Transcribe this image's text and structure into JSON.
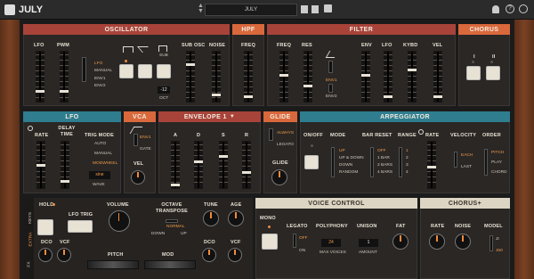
{
  "topbar": {
    "title": "JULY",
    "preset": "JULY"
  },
  "osc": {
    "title": "OSCILLATOR",
    "lfo": "LFO",
    "pwm": "PWM",
    "sub_osc": "SUB OSC",
    "noise": "NOISE",
    "mod": [
      "LFO",
      "MANUAL",
      "ENV1",
      "ENV2"
    ],
    "oct_value": "-12",
    "oct": "OCT",
    "sub": "SUB"
  },
  "hpf": {
    "title": "HPF",
    "freq": "FREQ"
  },
  "filter": {
    "title": "FILTER",
    "freq": "FREQ",
    "res": "RES",
    "env": "ENV",
    "lfo": "LFO",
    "kybd": "KYBD",
    "vel": "VEL",
    "env_opts": [
      "ENV1",
      "ENV2"
    ]
  },
  "chorus": {
    "title": "CHORUS",
    "i": "I",
    "ii": "II"
  },
  "lfo": {
    "title": "LFO",
    "rate": "RATE",
    "delay_time": "DELAY TIME",
    "trig_mode": "TRIG MODE",
    "trig_opts": [
      "AUTO",
      "MANUAL",
      "MODWHEEL"
    ],
    "wave": "WAVE",
    "wave_value": "sine"
  },
  "vca": {
    "title": "VCA",
    "env1": "ENV1",
    "gate": "GATE",
    "vel": "VEL"
  },
  "env1": {
    "title": "ENVELOPE 1",
    "a": "A",
    "d": "D",
    "s": "S",
    "r": "R"
  },
  "glide": {
    "title": "GLIDE",
    "always": "ALWAYS",
    "legato": "LEGATO",
    "glide": "GLIDE"
  },
  "arp": {
    "title": "ARPEGGIATOR",
    "onoff": "ON/OFF",
    "mode": "MODE",
    "modes": [
      "UP",
      "UP & DOWN",
      "DOWN",
      "RANDOM"
    ],
    "bar_reset": "BAR RESET",
    "bars": [
      "OFF",
      "1 BAR",
      "2 BARS",
      "4 BARS"
    ],
    "range": "RANGE",
    "ranges": [
      "1",
      "2",
      "3",
      "4"
    ],
    "rate": "RATE",
    "velocity": "VELOCITY",
    "each": "EACH",
    "last": "LAST",
    "order": "ORDER",
    "orders": [
      "PITCH",
      "PLAY",
      "CHORD"
    ]
  },
  "perf": {
    "tabs": [
      "KEYS",
      "EXTRA",
      "FX"
    ],
    "hold": "HOLD",
    "lfo_trig": "LFO TRIG",
    "volume": "VOLUME",
    "dco": "DCO",
    "vcf": "VCF",
    "pitch": "PITCH",
    "oct_transpose": "OCTAVE TRANSPOSE",
    "normal": "NORMAL",
    "down": "DOWN",
    "up": "UP",
    "tune": "TUNE",
    "age": "AGE",
    "mod": "MOD"
  },
  "voice": {
    "title": "VOICE CONTROL",
    "mono": "MONO",
    "legato": "LEGATO",
    "off": "OFF",
    "on": "ON",
    "polyphony": "POLYPHONY",
    "poly_value": "24",
    "max_voices": "MAX VOICES",
    "unison": "UNISON",
    "unison_value": "1",
    "amount": "AMOUNT",
    "fat": "FAT"
  },
  "chorusplus": {
    "title": "CHORUS+",
    "rate": "RATE",
    "noise": "NOISE",
    "model": "MODEL",
    "m1": "JI",
    "m2": "J60"
  }
}
